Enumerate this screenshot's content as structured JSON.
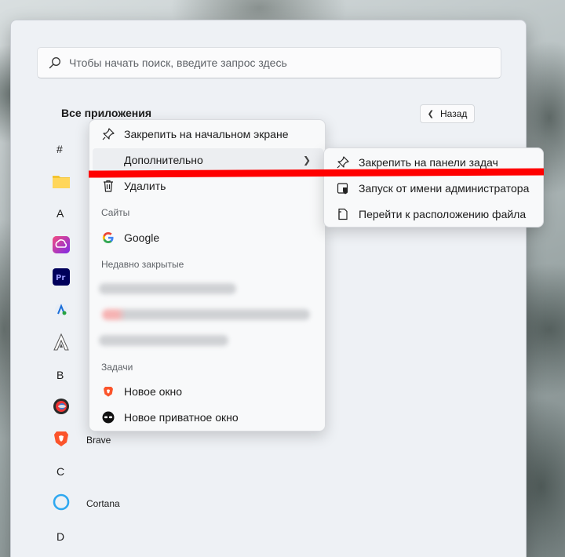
{
  "search": {
    "placeholder": "Чтобы начать поиск, введите запрос здесь"
  },
  "all_apps": {
    "title": "Все приложения",
    "back_label": "Назад"
  },
  "app_list": {
    "letters": [
      "#",
      "A",
      "B",
      "C",
      "D"
    ],
    "apps": [
      {
        "name": "Brave",
        "icon": "brave-icon"
      },
      {
        "name": "Cortana",
        "icon": "cortana-icon"
      }
    ]
  },
  "context_menu": {
    "pin_start": "Закрепить на начальном экране",
    "more": "Дополнительно",
    "uninstall": "Удалить",
    "sites_header": "Сайты",
    "site_google": "Google",
    "recent_header": "Недавно закрытые",
    "tasks_header": "Задачи",
    "task_new_window": "Новое окно",
    "task_private_window": "Новое приватное окно"
  },
  "submenu": {
    "pin_taskbar": "Закрепить на панели задач",
    "run_as_admin": "Запуск от имени администратора",
    "open_location": "Перейти к расположению файла"
  },
  "colors": {
    "accent_red": "#ff0000",
    "brave_orange": "#fb542b",
    "cortana_blue": "#2ea8f0"
  }
}
